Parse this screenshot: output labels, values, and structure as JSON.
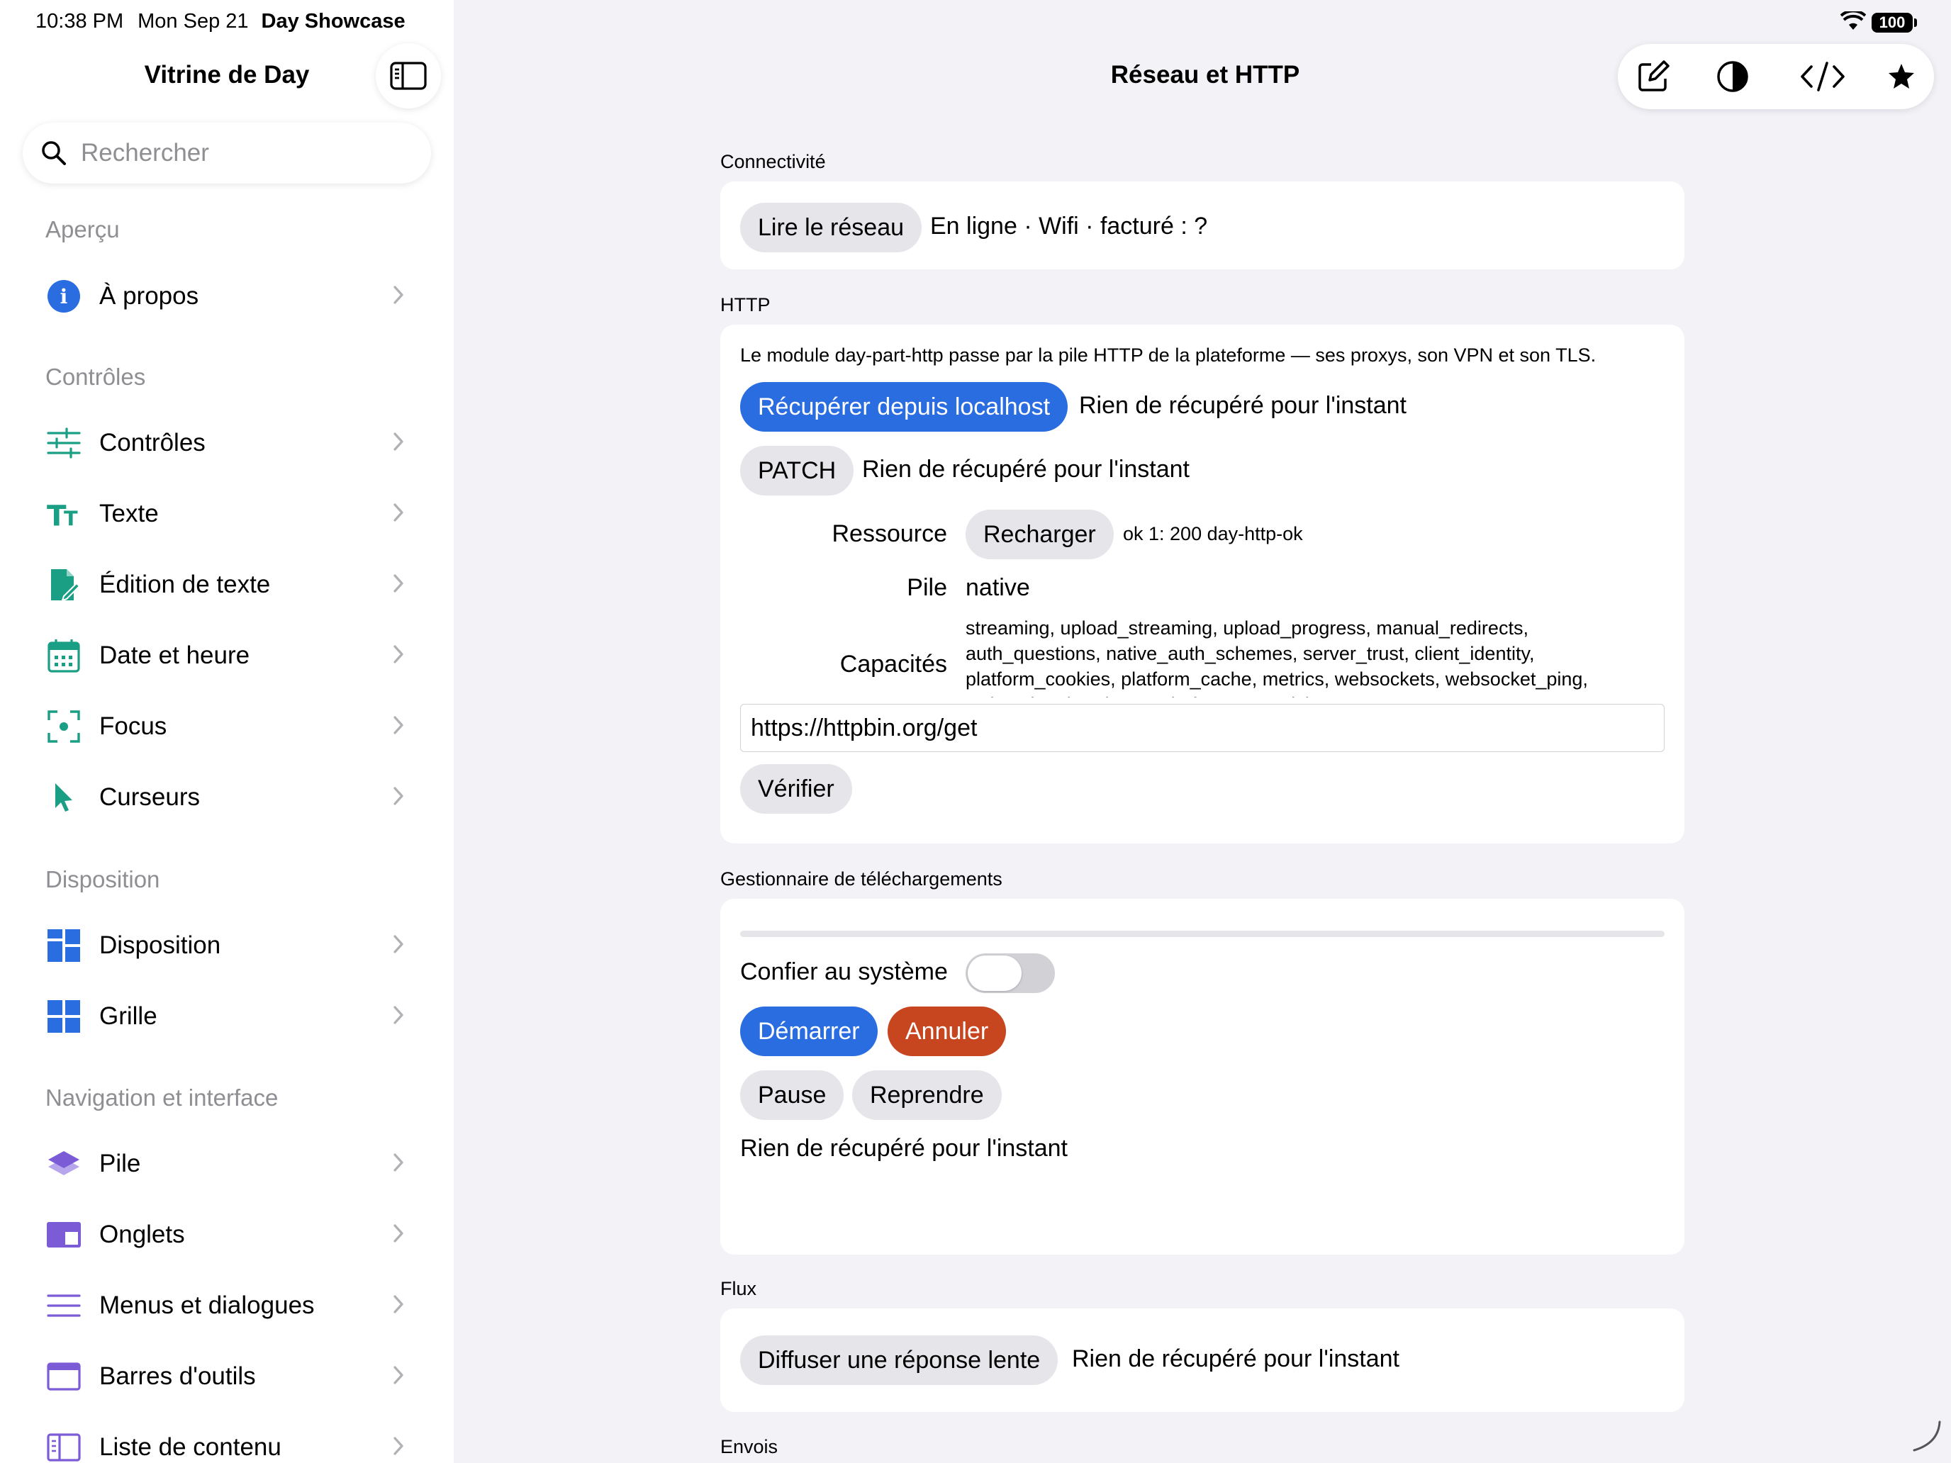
{
  "status_bar": {
    "time": "10:38 PM",
    "date": "Mon Sep 21",
    "app": "Day Showcase",
    "battery": "100"
  },
  "sidebar": {
    "title": "Vitrine de Day",
    "search_placeholder": "Rechercher",
    "sections": [
      {
        "header": "Aperçu",
        "items": [
          {
            "label": "À propos",
            "icon": "info-circle-icon",
            "color": "#2a6de1"
          }
        ]
      },
      {
        "header": "Contrôles",
        "items": [
          {
            "label": "Contrôles",
            "icon": "sliders-icon",
            "color": "#1a9e84"
          },
          {
            "label": "Texte",
            "icon": "text-size-icon",
            "color": "#1a9e84"
          },
          {
            "label": "Édition de texte",
            "icon": "document-edit-icon",
            "color": "#1a9e84"
          },
          {
            "label": "Date et heure",
            "icon": "calendar-icon",
            "color": "#1a9e84"
          },
          {
            "label": "Focus",
            "icon": "focus-viewfinder-icon",
            "color": "#1a9e84"
          },
          {
            "label": "Curseurs",
            "icon": "cursor-arrow-icon",
            "color": "#1a9e84"
          }
        ]
      },
      {
        "header": "Disposition",
        "items": [
          {
            "label": "Disposition",
            "icon": "layout-blocks-icon",
            "color": "#2a6de1"
          },
          {
            "label": "Grille",
            "icon": "grid-icon",
            "color": "#2a6de1"
          }
        ]
      },
      {
        "header": "Navigation et interface",
        "items": [
          {
            "label": "Pile",
            "icon": "stack-layers-icon",
            "color": "#7b5bd6"
          },
          {
            "label": "Onglets",
            "icon": "tabs-icon",
            "color": "#7b5bd6"
          },
          {
            "label": "Menus et dialogues",
            "icon": "menu-lines-icon",
            "color": "#7b5bd6"
          },
          {
            "label": "Barres d'outils",
            "icon": "toolbar-window-icon",
            "color": "#7b5bd6"
          },
          {
            "label": "Liste de contenu",
            "icon": "sidebar-list-icon",
            "color": "#7b5bd6"
          }
        ]
      }
    ]
  },
  "main": {
    "title": "Réseau et HTTP",
    "toolbar_icons": [
      "compose-icon",
      "contrast-icon",
      "code-icon",
      "star-icon"
    ],
    "connectivity": {
      "label": "Connectivité",
      "button": "Lire le réseau",
      "status": "En ligne · Wifi · facturé : ?"
    },
    "http": {
      "label": "HTTP",
      "description": "Le module day-part-http passe par la pile HTTP de la plateforme — ses proxys, son VPN et son TLS.",
      "fetch_button": "Récupérer depuis localhost",
      "fetch_result": "Rien de récupéré pour l'instant",
      "patch_button": "PATCH",
      "patch_result": "Rien de récupéré pour l'instant",
      "resource_label": "Ressource",
      "reload_button": "Recharger",
      "resource_value": "ok 1: 200 day-http-ok",
      "stack_label": "Pile",
      "stack_value": "native",
      "capabilities_label": "Capacités",
      "capabilities_value": "streaming, upload_streaming, upload_progress, manual_redirects, auth_questions, native_auth_schemes, server_trust, client_identity, platform_cookies, platform_cache, metrics, websockets, websocket_ping, websocket_headers, wait_for_connectivity",
      "url_value": "https://httpbin.org/get",
      "verify_button": "Vérifier"
    },
    "downloads": {
      "label": "Gestionnaire de téléchargements",
      "progress": 0,
      "delegate_label": "Confier au système",
      "delegate_on": false,
      "start_button": "Démarrer",
      "cancel_button": "Annuler",
      "pause_button": "Pause",
      "resume_button": "Reprendre",
      "result": "Rien de récupéré pour l'instant"
    },
    "stream": {
      "label": "Flux",
      "button": "Diffuser une réponse lente",
      "result": "Rien de récupéré pour l'instant"
    },
    "uploads": {
      "label": "Envois"
    }
  }
}
